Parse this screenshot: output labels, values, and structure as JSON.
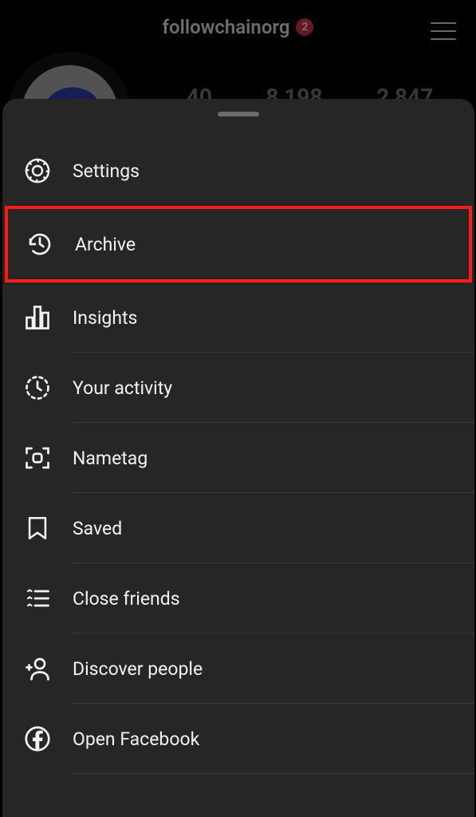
{
  "header": {
    "username": "followchainorg",
    "badge_count": "2"
  },
  "stats": {
    "val1": "40",
    "val2": "8,198",
    "val3": "2,847"
  },
  "menu": {
    "items": [
      {
        "icon": "settings-icon",
        "label": "Settings",
        "highlighted": false
      },
      {
        "icon": "archive-icon",
        "label": "Archive",
        "highlighted": true
      },
      {
        "icon": "insights-icon",
        "label": "Insights",
        "highlighted": false
      },
      {
        "icon": "activity-icon",
        "label": "Your activity",
        "highlighted": false
      },
      {
        "icon": "nametag-icon",
        "label": "Nametag",
        "highlighted": false
      },
      {
        "icon": "saved-icon",
        "label": "Saved",
        "highlighted": false
      },
      {
        "icon": "close-friends-icon",
        "label": "Close friends",
        "highlighted": false
      },
      {
        "icon": "discover-people-icon",
        "label": "Discover people",
        "highlighted": false
      },
      {
        "icon": "facebook-icon",
        "label": "Open Facebook",
        "highlighted": false
      }
    ]
  }
}
